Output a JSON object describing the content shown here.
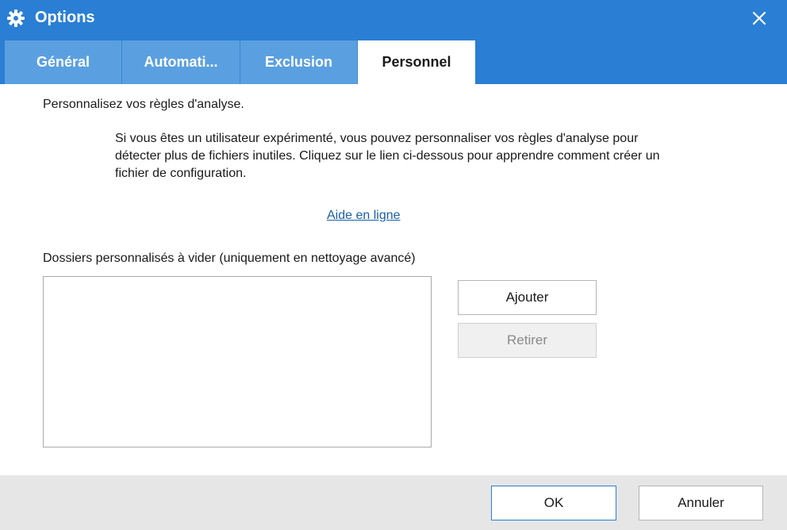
{
  "window": {
    "title": "Options",
    "title_icon": "gear-icon",
    "close_icon": "close-icon",
    "accent_color": "#2a7fd4"
  },
  "tabs": [
    {
      "label": "Général"
    },
    {
      "label": "Automati..."
    },
    {
      "label": "Exclusion"
    },
    {
      "label": "Personnel",
      "active": true
    }
  ],
  "content": {
    "section_title": "Personnalisez vos règles d'analyse.",
    "description": "Si vous êtes un utilisateur expérimenté, vous pouvez personnaliser vos règles d'analyse pour détecter plus de fichiers inutiles. Cliquez sur le lien ci-dessous pour apprendre comment créer un fichier de configuration.",
    "help_link": "Aide en ligne",
    "folders_label": "Dossiers personnalisés à vider (uniquement en nettoyage avancé)",
    "folders": []
  },
  "buttons": {
    "add": "Ajouter",
    "remove": "Retirer",
    "ok": "OK",
    "cancel": "Annuler"
  }
}
